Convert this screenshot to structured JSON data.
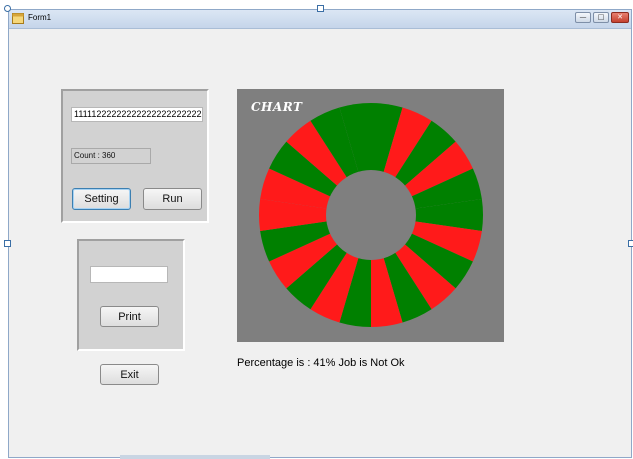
{
  "window": {
    "title": "Form1",
    "minimize_glyph": "—",
    "maximize_glyph": "□",
    "close_glyph": "✕"
  },
  "input_panel": {
    "sequence_value": "11111222222222222222222222222",
    "count_label": "Count : 360",
    "setting_button": "Setting",
    "run_button": "Run"
  },
  "print_panel": {
    "text_value": "",
    "print_button": "Print"
  },
  "exit_button": "Exit",
  "chart": {
    "title": "CHART",
    "background_color": "#7f7f7f",
    "ok_color": "#008000",
    "not_ok_color": "#ff1a1a",
    "hole_color": "#7f7f7f",
    "segments_sequence": [
      "green",
      "red",
      "green",
      "red",
      "green",
      "green",
      "red",
      "green",
      "red",
      "green",
      "red",
      "green",
      "red",
      "green",
      "red",
      "green",
      "red",
      "red",
      "green",
      "red",
      "green",
      "green"
    ]
  },
  "result_text": "Percentage is : 41% Job is Not Ok"
}
